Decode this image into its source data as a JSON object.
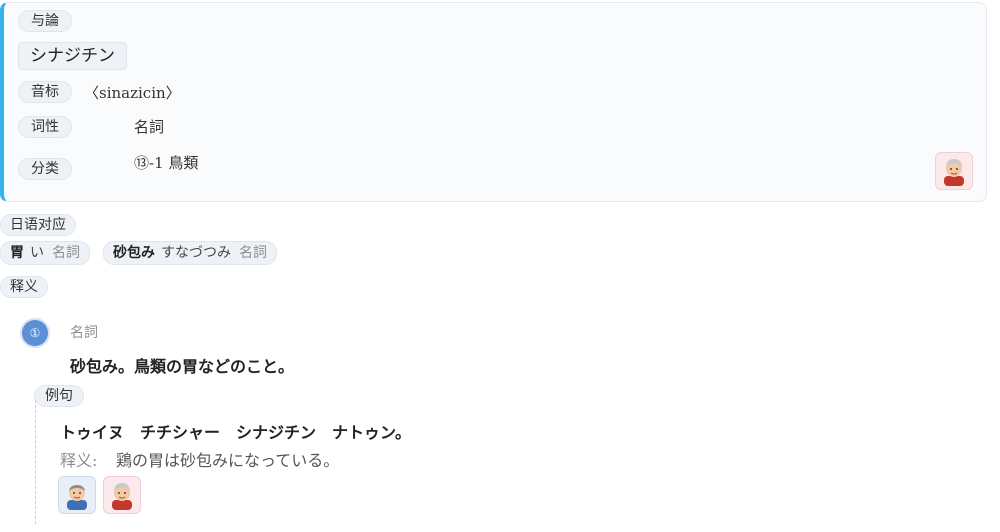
{
  "entry": {
    "dialect_tag": "与論",
    "headword": "シナジチン",
    "phonetic_label": "音标",
    "phonetic_value": "〈sinazicin〉",
    "pos_label": "词性",
    "pos_value": "名詞",
    "category_label": "分类",
    "category_value": "⑬-1 鳥類",
    "speaker_icon": "elderly-woman-avatar-icon"
  },
  "japanese": {
    "section_label": "日语对应",
    "items": [
      {
        "word": "胃",
        "kana": "い",
        "pos": "名詞"
      },
      {
        "word": "砂包み",
        "kana": "すなづつみ",
        "pos": "名詞"
      }
    ]
  },
  "definition": {
    "section_label": "释义",
    "senses": [
      {
        "number": "①",
        "pos": "名詞",
        "text": "砂包み。鳥類の胃などのこと。",
        "example_label": "例句",
        "example_sentence": "トゥイヌ　チチシャー　シナジチン　ナトゥン。",
        "translation_label": "释义:",
        "translation_text": "鶏の胃は砂包みになっている。",
        "speakers": [
          "elderly-man-avatar-icon",
          "elderly-woman-avatar-icon"
        ]
      }
    ]
  },
  "colors": {
    "accent_bar": "#36b2ec",
    "number_badge": "#5b8fd6"
  }
}
